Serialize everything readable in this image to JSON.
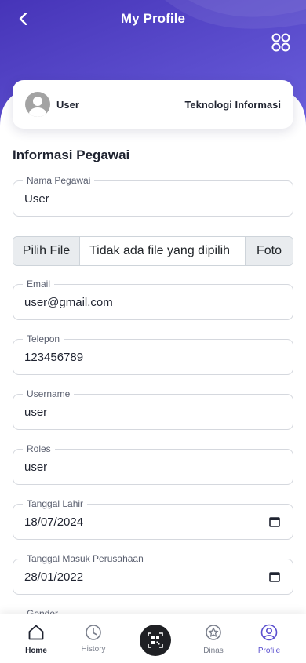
{
  "header": {
    "title": "My Profile",
    "back_icon": "chevron-left-icon",
    "menu_icon": "grid-circles-icon",
    "gradient_from": "#4634b8",
    "gradient_to": "#6a5fdc"
  },
  "profile_card": {
    "name": "User",
    "department": "Teknologi Informasi"
  },
  "section": {
    "title": "Informasi Pegawai"
  },
  "form": {
    "nama_pegawai": {
      "label": "Nama Pegawai",
      "value": "User"
    },
    "foto": {
      "button_label": "Pilih File",
      "file_text": "Tidak ada file yang dipilih",
      "suffix": "Foto"
    },
    "email": {
      "label": "Email",
      "value": "user@gmail.com"
    },
    "telepon": {
      "label": "Telepon",
      "value": "123456789"
    },
    "username": {
      "label": "Username",
      "value": "user"
    },
    "roles": {
      "label": "Roles",
      "value": "user"
    },
    "tanggal_lahir": {
      "label": "Tanggal Lahir",
      "value": "18/07/2024"
    },
    "tanggal_masuk": {
      "label": "Tanggal Masuk Perusahaan",
      "value": "28/01/2022"
    },
    "gender": {
      "label": "Gender"
    }
  },
  "bottom_nav": {
    "items": [
      {
        "label": "Home",
        "icon": "home-icon",
        "active": true
      },
      {
        "label": "History",
        "icon": "clock-icon",
        "active": false
      },
      {
        "label": "",
        "icon": "qr-scan-icon",
        "active": false
      },
      {
        "label": "Dinas",
        "icon": "star-badge-icon",
        "active": false
      },
      {
        "label": "Profile",
        "icon": "user-circle-icon",
        "active": false
      }
    ]
  },
  "colors": {
    "accent": "#5a4fcf",
    "text": "#1f2330",
    "border": "#d5d8de"
  }
}
